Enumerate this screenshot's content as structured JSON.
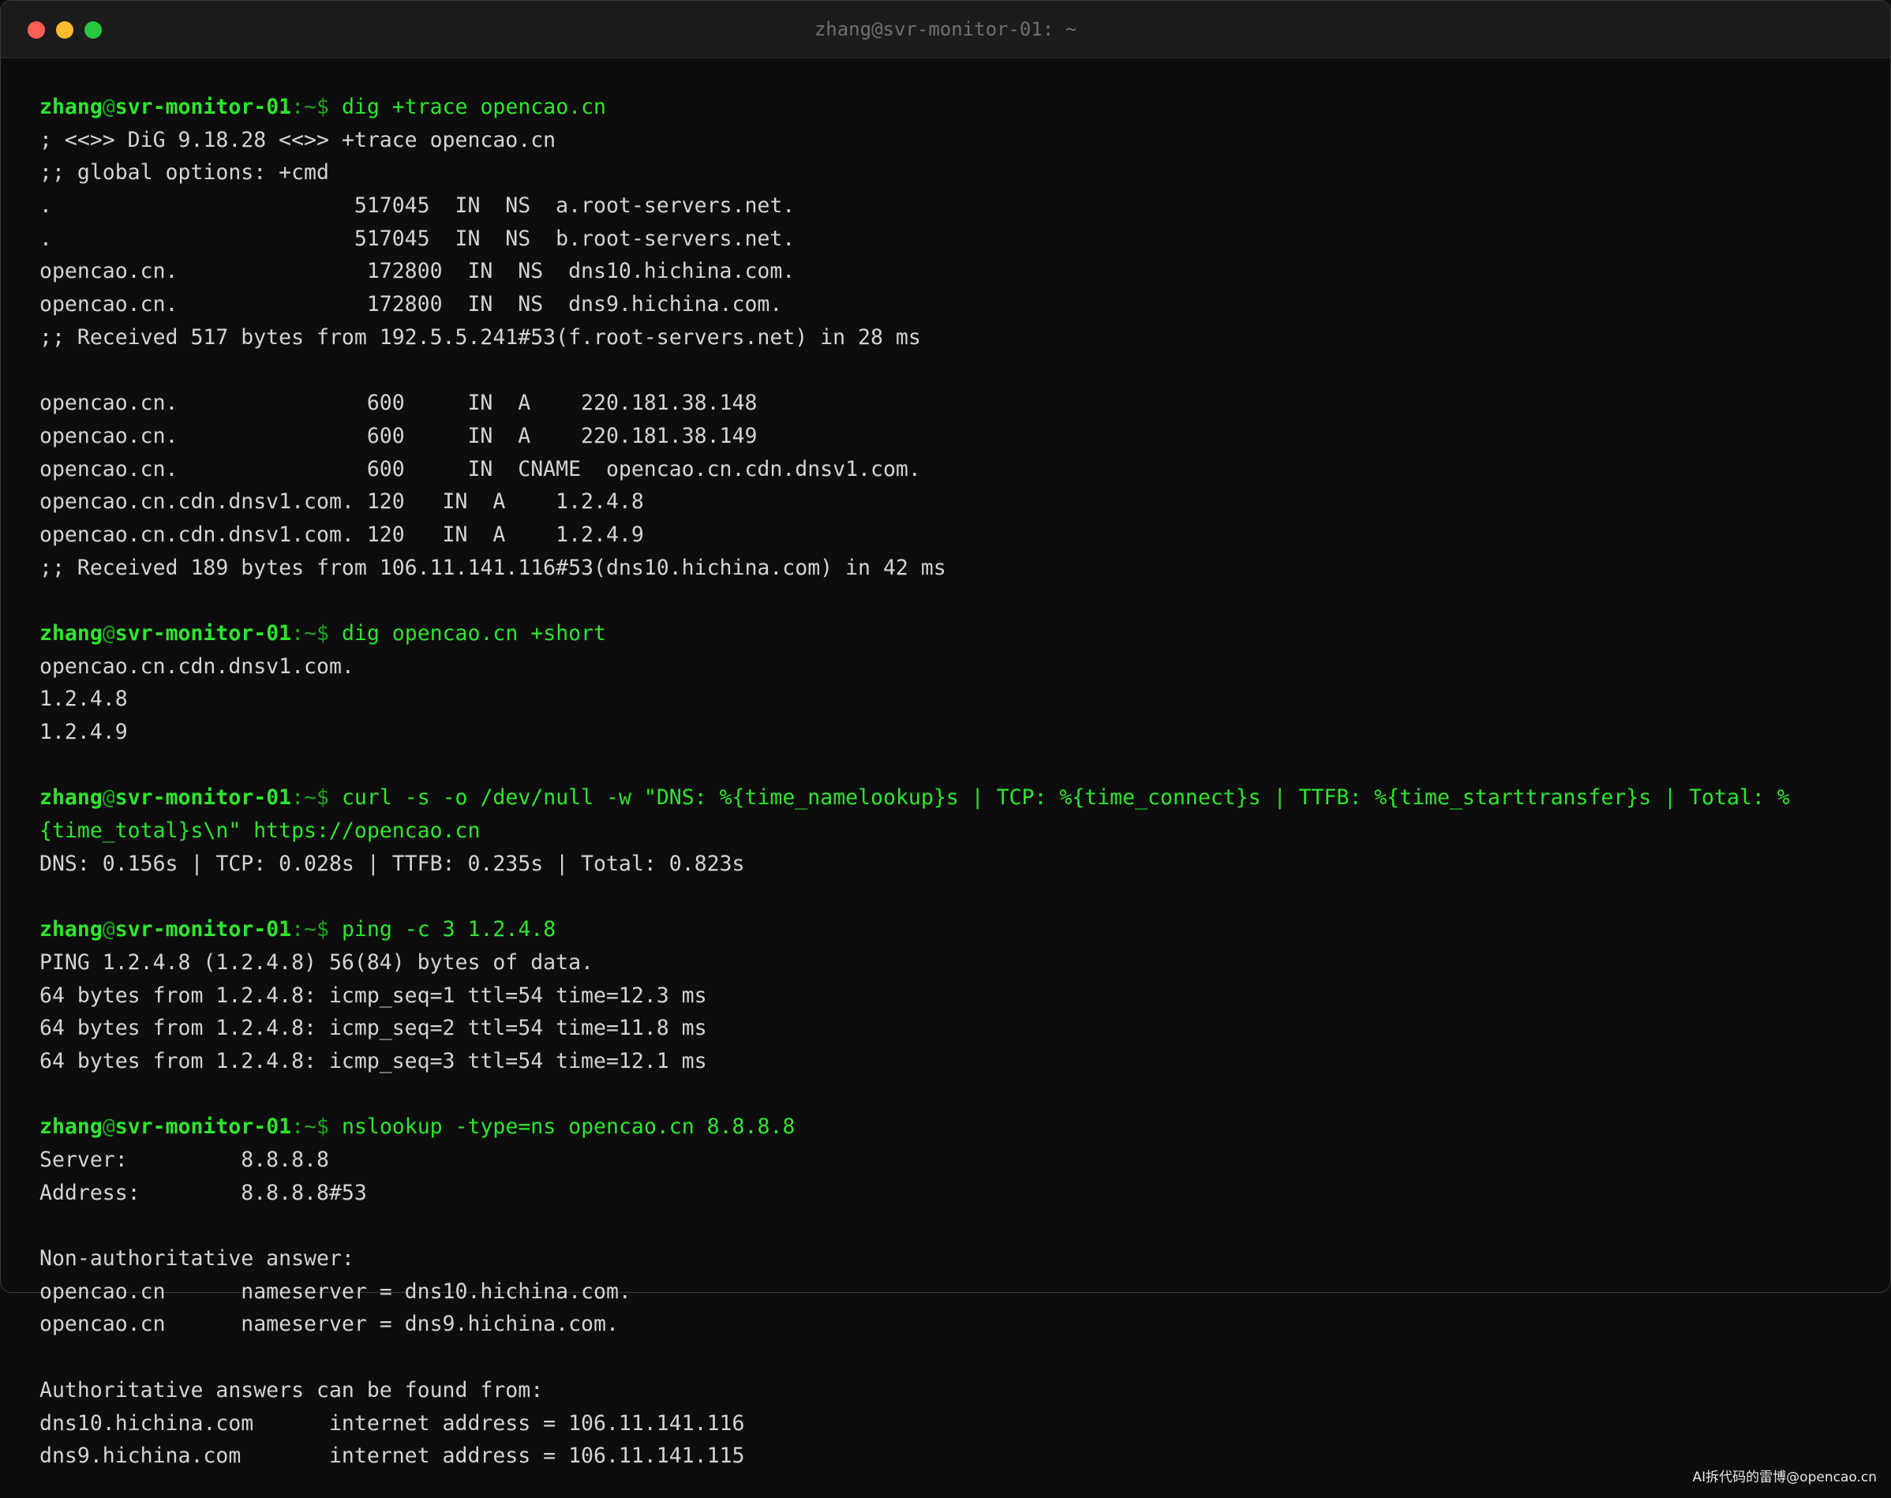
{
  "window": {
    "title": "zhang@svr-monitor-01: ~"
  },
  "colors": {
    "prompt": "#2ee62e",
    "output": "#d4d4d4",
    "background": "#0d0d0d",
    "close": "#ff5f57",
    "minimize": "#febc2e",
    "maximize": "#28c840"
  },
  "prompt": {
    "user": "zhang",
    "at": "@",
    "host": "svr-monitor-01",
    "path": ":~",
    "dollar": "$ "
  },
  "lines": [
    {
      "type": "prompt",
      "text": "dig +trace opencao.cn"
    },
    {
      "type": "output",
      "text": "; <<>> DiG 9.18.28 <<>> +trace opencao.cn"
    },
    {
      "type": "output",
      "text": ";; global options: +cmd"
    },
    {
      "type": "output",
      "text": ".                        517045  IN  NS  a.root-servers.net."
    },
    {
      "type": "output",
      "text": ".                        517045  IN  NS  b.root-servers.net."
    },
    {
      "type": "output",
      "text": "opencao.cn.               172800  IN  NS  dns10.hichina.com."
    },
    {
      "type": "output",
      "text": "opencao.cn.               172800  IN  NS  dns9.hichina.com."
    },
    {
      "type": "output",
      "text": ";; Received 517 bytes from 192.5.5.241#53(f.root-servers.net) in 28 ms"
    },
    {
      "type": "blank",
      "text": ""
    },
    {
      "type": "output",
      "text": "opencao.cn.               600     IN  A    220.181.38.148"
    },
    {
      "type": "output",
      "text": "opencao.cn.               600     IN  A    220.181.38.149"
    },
    {
      "type": "output",
      "text": "opencao.cn.               600     IN  CNAME  opencao.cn.cdn.dnsv1.com."
    },
    {
      "type": "output",
      "text": "opencao.cn.cdn.dnsv1.com. 120   IN  A    1.2.4.8"
    },
    {
      "type": "output",
      "text": "opencao.cn.cdn.dnsv1.com. 120   IN  A    1.2.4.9"
    },
    {
      "type": "output",
      "text": ";; Received 189 bytes from 106.11.141.116#53(dns10.hichina.com) in 42 ms"
    },
    {
      "type": "blank",
      "text": ""
    },
    {
      "type": "prompt",
      "text": "dig opencao.cn +short"
    },
    {
      "type": "output",
      "text": "opencao.cn.cdn.dnsv1.com."
    },
    {
      "type": "output",
      "text": "1.2.4.8"
    },
    {
      "type": "output",
      "text": "1.2.4.9"
    },
    {
      "type": "blank",
      "text": ""
    },
    {
      "type": "prompt",
      "text": "curl -s -o /dev/null -w \"DNS: %{time_namelookup}s | TCP: %{time_connect}s | TTFB: %{time_starttransfer}s | Total: %"
    },
    {
      "type": "cmd-cont",
      "text": "{time_total}s\\n\" https://opencao.cn"
    },
    {
      "type": "output",
      "text": "DNS: 0.156s | TCP: 0.028s | TTFB: 0.235s | Total: 0.823s"
    },
    {
      "type": "blank",
      "text": ""
    },
    {
      "type": "prompt",
      "text": "ping -c 3 1.2.4.8"
    },
    {
      "type": "output",
      "text": "PING 1.2.4.8 (1.2.4.8) 56(84) bytes of data."
    },
    {
      "type": "output",
      "text": "64 bytes from 1.2.4.8: icmp_seq=1 ttl=54 time=12.3 ms"
    },
    {
      "type": "output",
      "text": "64 bytes from 1.2.4.8: icmp_seq=2 ttl=54 time=11.8 ms"
    },
    {
      "type": "output",
      "text": "64 bytes from 1.2.4.8: icmp_seq=3 ttl=54 time=12.1 ms"
    },
    {
      "type": "blank",
      "text": ""
    },
    {
      "type": "prompt",
      "text": "nslookup -type=ns opencao.cn 8.8.8.8"
    },
    {
      "type": "output",
      "text": "Server:         8.8.8.8"
    },
    {
      "type": "output",
      "text": "Address:        8.8.8.8#53"
    },
    {
      "type": "blank",
      "text": ""
    },
    {
      "type": "output",
      "text": "Non-authoritative answer:"
    },
    {
      "type": "output",
      "text": "opencao.cn      nameserver = dns10.hichina.com."
    },
    {
      "type": "output",
      "text": "opencao.cn      nameserver = dns9.hichina.com."
    },
    {
      "type": "blank",
      "text": ""
    },
    {
      "type": "output",
      "text": "Authoritative answers can be found from:"
    },
    {
      "type": "output",
      "text": "dns10.hichina.com      internet address = 106.11.141.116"
    },
    {
      "type": "output",
      "text": "dns9.hichina.com       internet address = 106.11.141.115"
    }
  ],
  "watermark": "AI拆代码的雷博@opencao.cn"
}
